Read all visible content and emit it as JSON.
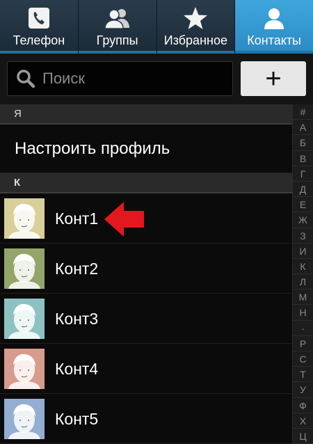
{
  "tabs": [
    {
      "label": "Телефон",
      "icon": "phone-icon",
      "active": false
    },
    {
      "label": "Группы",
      "icon": "group-icon",
      "active": false
    },
    {
      "label": "Избранное",
      "icon": "star-icon",
      "active": false
    },
    {
      "label": "Контакты",
      "icon": "contact-icon",
      "active": true
    }
  ],
  "search": {
    "placeholder": "Поиск"
  },
  "add_button": {
    "label": "+"
  },
  "sections": [
    {
      "header": "Я",
      "profile_label": "Настроить профиль"
    },
    {
      "header": "К"
    }
  ],
  "contacts": [
    {
      "name": "Конт1",
      "avatar_color": "#d8cf9a"
    },
    {
      "name": "Конт2",
      "avatar_color": "#93a56a"
    },
    {
      "name": "Конт3",
      "avatar_color": "#8cc3c2"
    },
    {
      "name": "Конт4",
      "avatar_color": "#d79c8e"
    },
    {
      "name": "Конт5",
      "avatar_color": "#94aed2"
    }
  ],
  "index_letters": [
    "#",
    "А",
    "Б",
    "В",
    "Г",
    "Д",
    "Е",
    "Ж",
    "З",
    "И",
    "К",
    "Л",
    "М",
    "Н",
    "·",
    "Р",
    "С",
    "Т",
    "У",
    "Ф",
    "Х",
    "Ц"
  ],
  "colors": {
    "accent": "#3fa7dd",
    "arrow": "#e3171e"
  }
}
